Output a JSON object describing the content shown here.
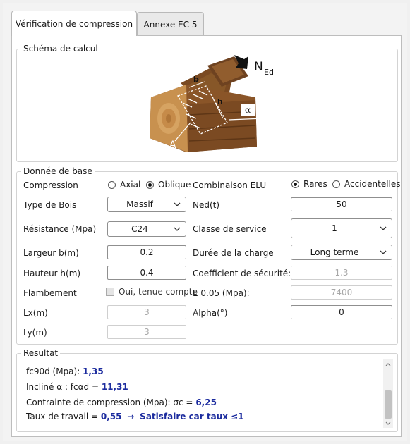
{
  "tabs": [
    {
      "label": "Vérification de compression",
      "active": true
    },
    {
      "label": "Annexe EC 5",
      "active": false
    }
  ],
  "schema": {
    "title": "Schéma de calcul",
    "labels": {
      "b": "b",
      "h": "h",
      "A": "A",
      "alpha": "α",
      "ned": "N",
      "ned_sub": "Ed"
    }
  },
  "base": {
    "title": "Donnée de base",
    "compression_label": "Compression",
    "compression_options": [
      "Axial",
      "Oblique"
    ],
    "compression_selected": "Oblique",
    "type_bois_label": "Type de Bois",
    "type_bois_value": "Massif",
    "resistance_label": "Résistance (Mpa)",
    "resistance_value": "C24",
    "largeur_label": "Largeur b(m)",
    "largeur_value": "0.2",
    "hauteur_label": "Hauteur h(m)",
    "hauteur_value": "0.4",
    "flambement_label": "Flambement",
    "flambement_checkbox": "Oui, tenue compte",
    "lx_label": "Lx(m)",
    "lx_value": "3",
    "ly_label": "Ly(m)",
    "ly_value": "3",
    "combinaison_label": "Combinaison ELU",
    "combinaison_options": [
      "Rares",
      "Accidentelles"
    ],
    "combinaison_selected": "Rares",
    "ned_label": "Ned(t)",
    "ned_value": "50",
    "classe_label": "Classe de service",
    "classe_value": "1",
    "duree_label": "Durée de la charge",
    "duree_value": "Long terme",
    "coef_label": "Coefficient de sécurité:",
    "coef_value": "1.3",
    "e005_label": "E 0.05 (Mpa):",
    "e005_value": "7400",
    "alpha_label": "Alpha(°)",
    "alpha_value": "0"
  },
  "result": {
    "title": "Resultat",
    "line1_label": "fc90d (Mpa): ",
    "line1_value": "1,35",
    "line2_label": "Incliné α : fcαd = ",
    "line2_value": "11,31",
    "line3_label": "Contrainte de compression (Mpa): σc = ",
    "line3_value": "6,25",
    "line4_label": "Taux de travail = ",
    "line4_value": "0,55",
    "line4_arrow": "→",
    "line4_verdict": "Satisfaire car taux ≤1"
  },
  "colors": {
    "accent_text": "#1b2b9e"
  }
}
